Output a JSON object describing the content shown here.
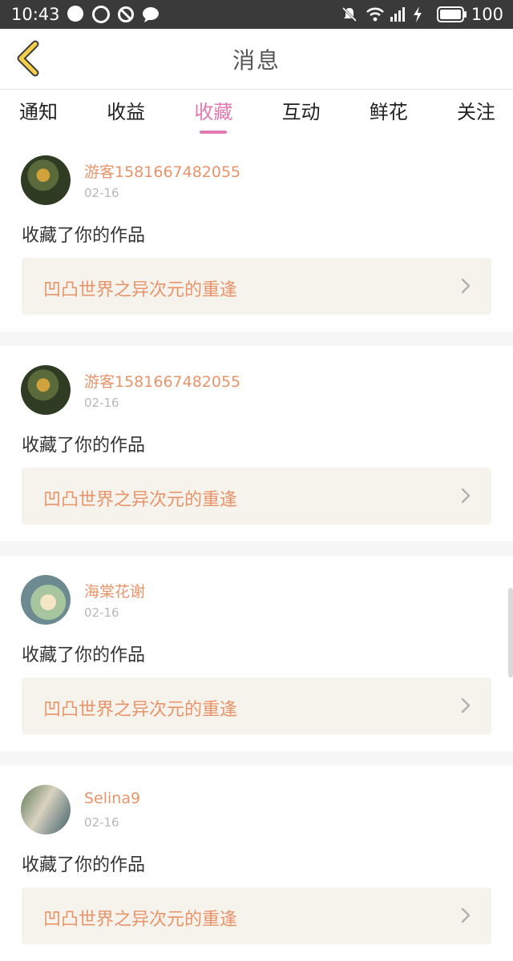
{
  "status_bar": {
    "time": "10:43",
    "battery": "100"
  },
  "header": {
    "title": "消息"
  },
  "tabs": [
    {
      "label": "通知"
    },
    {
      "label": "收益"
    },
    {
      "label": "收藏"
    },
    {
      "label": "互动"
    },
    {
      "label": "鲜花"
    },
    {
      "label": "关注"
    }
  ],
  "active_tab": "收藏",
  "items": [
    {
      "user": "游客1581667482055",
      "date": "02-16",
      "action": "收藏了你的作品",
      "work": "凹凸世界之异次元的重逢"
    },
    {
      "user": "游客1581667482055",
      "date": "02-16",
      "action": "收藏了你的作品",
      "work": "凹凸世界之异次元的重逢"
    },
    {
      "user": "海棠花谢",
      "date": "02-16",
      "action": "收藏了你的作品",
      "work": "凹凸世界之异次元的重逢"
    },
    {
      "user": "Selina9",
      "date": "02-16",
      "action": "收藏了你的作品",
      "work": "凹凸世界之异次元的重逢"
    }
  ],
  "colors": {
    "accent": "#e07ab0",
    "name": "#e8946a",
    "card_bg": "#f5f3ec",
    "status_bar": "#3a3a3a"
  }
}
